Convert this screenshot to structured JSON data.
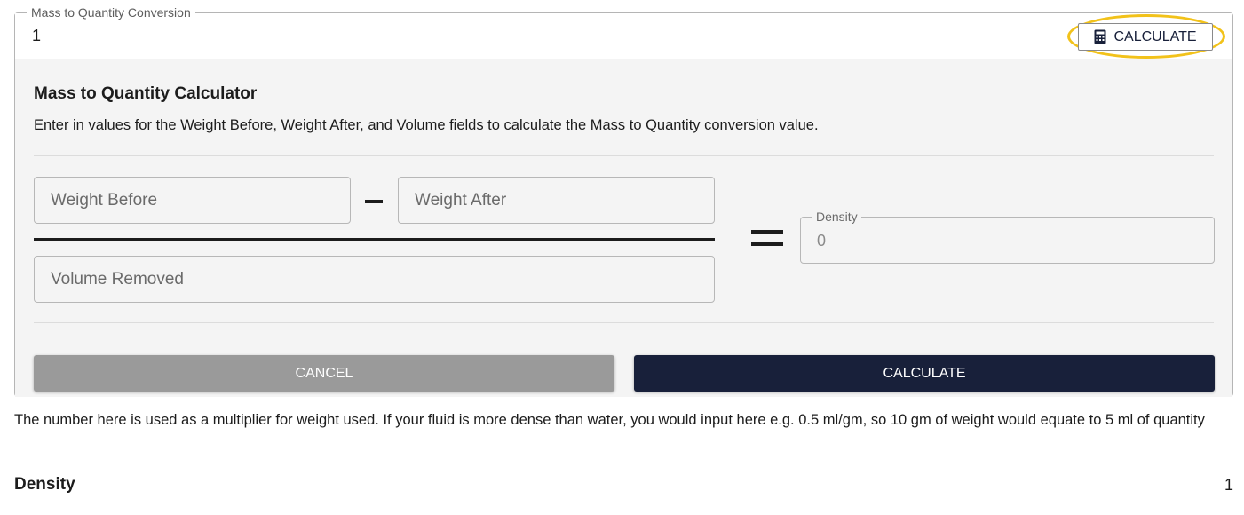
{
  "conversion_field": {
    "label": "Mass to Quantity Conversion",
    "value": "1",
    "calculate_button_label": "CALCULATE",
    "calculator_icon": "calculator-icon",
    "highlight_color": "#f2c21a"
  },
  "calculator": {
    "title": "Mass to Quantity Calculator",
    "description": "Enter in values for the Weight Before, Weight After, and Volume fields to calculate the Mass to Quantity conversion value.",
    "weight_before_placeholder": "Weight Before",
    "weight_after_placeholder": "Weight After",
    "volume_removed_placeholder": "Volume Removed",
    "density_label": "Density",
    "density_value": "0",
    "cancel_label": "CANCEL",
    "calculate_label": "CALCULATE",
    "primary_color": "#18203a",
    "cancel_color": "#9a9a9a"
  },
  "help_text": "The number here is used as a multiplier for weight used. If your fluid is more dense than water, you would input here e.g. 0.5 ml/gm, so 10 gm of weight would equate to 5 ml of quantity",
  "summary": {
    "label": "Density",
    "value": "1"
  }
}
